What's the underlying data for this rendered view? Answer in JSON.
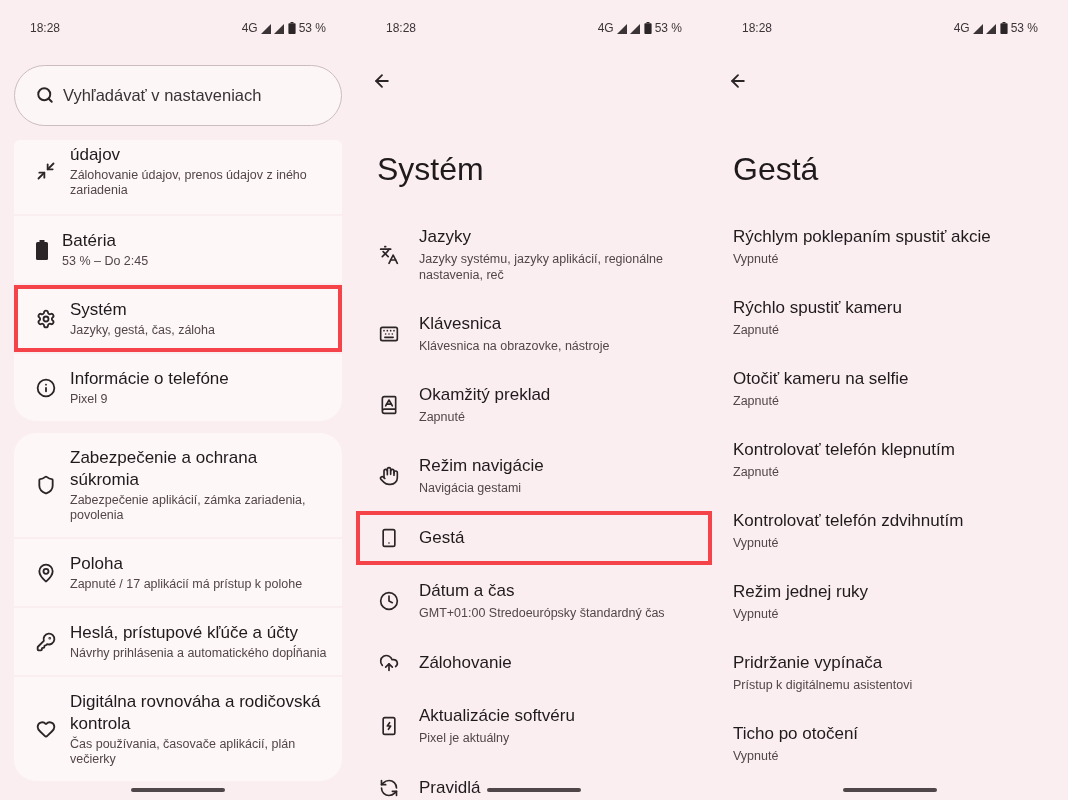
{
  "panels": [
    {
      "kind": "home",
      "status_bar": {
        "time": "18:28",
        "network": "4G",
        "battery": "53 %"
      },
      "search": {
        "placeholder": "Vyhľadávať v nastaveniach"
      },
      "groups": [
        {
          "items": [
            {
              "title": "údajov",
              "subtitle": "Zálohovanie údajov, prenos údajov z iného zariadenia",
              "highlighted": false
            },
            {
              "title": "Batéria",
              "subtitle": "53 % – Do 2:45",
              "highlighted": false
            },
            {
              "title": "Systém",
              "subtitle": "Jazyky, gestá, čas, záloha",
              "highlighted": true
            },
            {
              "title": "Informácie o telefóne",
              "subtitle": "Pixel 9",
              "highlighted": false
            }
          ]
        },
        {
          "items": [
            {
              "title": "Zabezpečenie a ochrana súkromia",
              "subtitle": "Zabezpečenie aplikácií, zámka zariadenia, povolenia",
              "highlighted": false
            },
            {
              "title": "Poloha",
              "subtitle": "Zapnuté / 17 aplikácií má prístup k polohe",
              "highlighted": false
            },
            {
              "title": "Heslá, prístupové kľúče a účty",
              "subtitle": "Návrhy prihlásenia a automatického dopĺňania",
              "highlighted": false
            },
            {
              "title": "Digitálna rovnováha a rodičovská kontrola",
              "subtitle": "Čas používania, časovače aplikácií, plán večierky",
              "highlighted": false
            }
          ]
        }
      ]
    },
    {
      "kind": "subpage",
      "status_bar": {
        "time": "18:28",
        "network": "4G",
        "battery": "53 %"
      },
      "title": "Systém",
      "items": [
        {
          "title": "Jazyky",
          "subtitle": "Jazyky systému, jazyky aplikácií, regionálne nastavenia, reč",
          "highlighted": false
        },
        {
          "title": "Klávesnica",
          "subtitle": "Klávesnica na obrazovke, nástroje",
          "highlighted": false
        },
        {
          "title": "Okamžitý preklad",
          "subtitle": "Zapnuté",
          "highlighted": false
        },
        {
          "title": "Režim navigácie",
          "subtitle": "Navigácia gestami",
          "highlighted": false
        },
        {
          "title": "Gestá",
          "highlighted": true
        },
        {
          "title": "Dátum a čas",
          "subtitle": "GMT+01:00 Stredoeurópsky štandardný čas",
          "highlighted": false
        },
        {
          "title": "Zálohovanie",
          "highlighted": false
        },
        {
          "title": "Aktualizácie softvéru",
          "subtitle": "Pixel je aktuálny",
          "highlighted": false
        },
        {
          "title": "Pravidlá",
          "highlighted": false
        }
      ]
    },
    {
      "kind": "plain_subpage",
      "status_bar": {
        "time": "18:28",
        "network": "4G",
        "battery": "53 %"
      },
      "title": "Gestá",
      "items": [
        {
          "title": "Rýchlym poklepaním spustiť akcie",
          "subtitle": "Vypnuté",
          "highlighted": false
        },
        {
          "title": "Rýchlo spustiť kameru",
          "subtitle": "Zapnuté",
          "highlighted": false
        },
        {
          "title": "Otočiť kameru na selfie",
          "subtitle": "Zapnuté",
          "highlighted": false
        },
        {
          "title": "Kontrolovať telefón klepnutím",
          "subtitle": "Zapnuté",
          "highlighted": false
        },
        {
          "title": "Kontrolovať telefón zdvihnutím",
          "subtitle": "Vypnuté",
          "highlighted": false
        },
        {
          "title": "Režim jednej ruky",
          "subtitle": "Vypnuté",
          "highlighted": false
        },
        {
          "title": "Pridržanie vypínača",
          "subtitle": "Prístup k digitálnemu asistentovi",
          "highlighted": false
        },
        {
          "title": "Ticho po otočení",
          "subtitle": "Vypnuté",
          "highlighted": false
        }
      ]
    }
  ]
}
